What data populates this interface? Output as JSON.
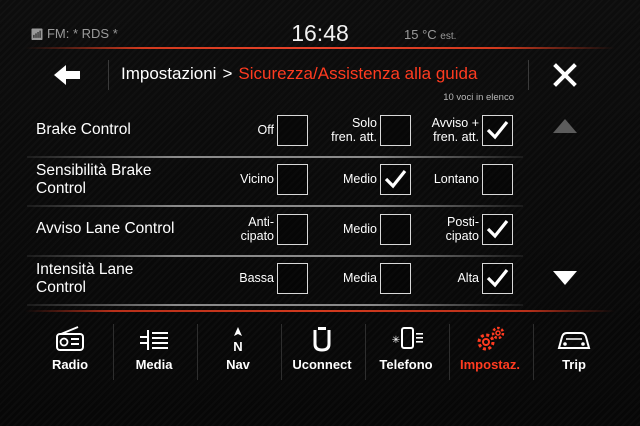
{
  "status_bar": {
    "radio": "FM: * RDS *",
    "clock": "16:48",
    "temperature": "15 °C",
    "temperature_note": "est."
  },
  "header": {
    "crumb": "Impostazioni",
    "separator": ">",
    "current": "Sicurezza/Assistenza alla guida",
    "item_count": "10 voci in elenco"
  },
  "settings": [
    {
      "label": "Brake Control",
      "options": [
        {
          "label": "Off",
          "checked": false
        },
        {
          "label": "Solo\nfren. att.",
          "checked": false
        },
        {
          "label": "Avviso +\nfren. att.",
          "checked": true
        }
      ]
    },
    {
      "label": "Sensibilità Brake\nControl",
      "options": [
        {
          "label": "Vicino",
          "checked": false
        },
        {
          "label": "Medio",
          "checked": true
        },
        {
          "label": "Lontano",
          "checked": false
        }
      ]
    },
    {
      "label": "Avviso Lane Control",
      "options": [
        {
          "label": "Anti-\ncipato",
          "checked": false
        },
        {
          "label": "Medio",
          "checked": false
        },
        {
          "label": "Posti-\ncipato",
          "checked": true
        }
      ]
    },
    {
      "label": "Intensità Lane\nControl",
      "options": [
        {
          "label": "Bassa",
          "checked": false
        },
        {
          "label": "Media",
          "checked": false
        },
        {
          "label": "Alta",
          "checked": true
        }
      ]
    }
  ],
  "nav": {
    "items": [
      {
        "label": "Radio",
        "icon": "radio-icon",
        "active": false
      },
      {
        "label": "Media",
        "icon": "media-icon",
        "active": false
      },
      {
        "label": "Nav",
        "icon": "nav-compass-icon",
        "active": false
      },
      {
        "label": "Uconnect",
        "icon": "uconnect-icon",
        "active": false
      },
      {
        "label": "Telefono",
        "icon": "phone-icon",
        "active": false
      },
      {
        "label": "Impostaz.",
        "icon": "settings-gears-icon",
        "active": true
      },
      {
        "label": "Trip",
        "icon": "trip-car-icon",
        "active": false
      }
    ]
  },
  "colors": {
    "accent": "#ff3b20",
    "text": "#ffffff",
    "background": "#080808"
  }
}
